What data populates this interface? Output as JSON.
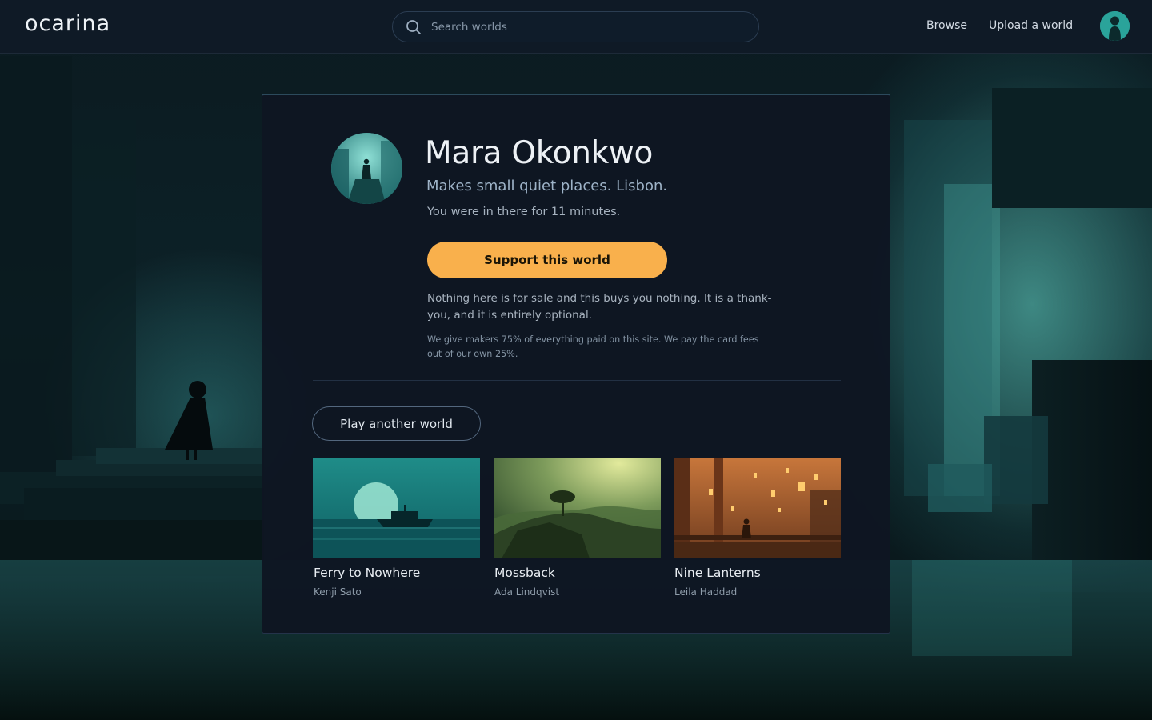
{
  "app": {
    "logo": "ocarina"
  },
  "search": {
    "placeholder": "Search worlds",
    "value": ""
  },
  "nav": {
    "browse": "Browse",
    "upload": "Upload a world"
  },
  "maker": {
    "name": "Mara Okonkwo",
    "bio": "Makes small quiet places. Lisbon.",
    "time_spent": "You were in there for 11 minutes."
  },
  "support": {
    "button_label": "Support this world",
    "note": "Nothing here is for sale and this buys you nothing. It is a thank-you, and it is entirely optional.",
    "fine_print": "We give makers 75% of everything paid on this site. We pay the card fees out of our own 25%."
  },
  "play_another": {
    "label": "Play another world"
  },
  "worlds": [
    {
      "title": "Ferry to Nowhere",
      "author": "Kenji Sato"
    },
    {
      "title": "Mossback",
      "author": "Ada Lindqvist"
    },
    {
      "title": "Nine Lanterns",
      "author": "Leila Haddad"
    }
  ],
  "colors": {
    "accent": "#f9b04c",
    "topbar": "#0f1a26",
    "card": "#0e1622",
    "teal": "#2b9b97"
  }
}
